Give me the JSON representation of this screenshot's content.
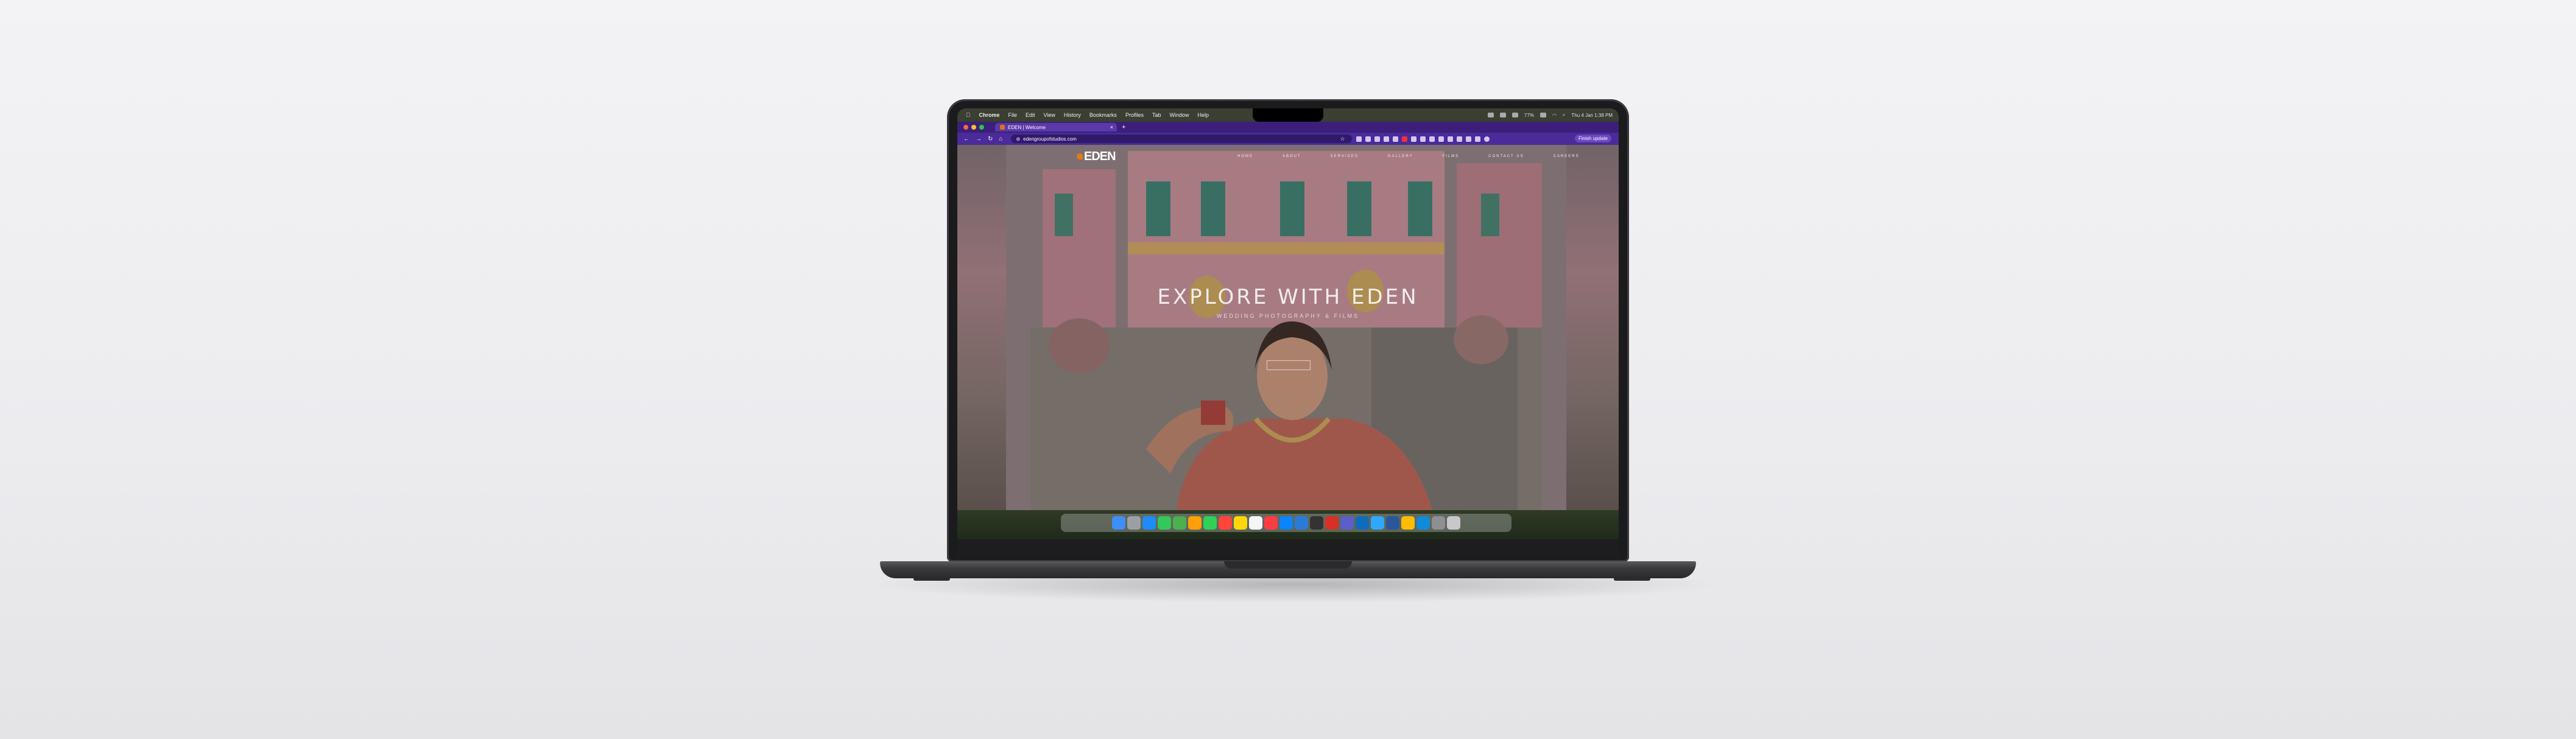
{
  "menubar": {
    "app_name": "Chrome",
    "items": [
      "File",
      "Edit",
      "View",
      "History",
      "Bookmarks",
      "Profiles",
      "Tab",
      "Window",
      "Help"
    ],
    "battery": "77%",
    "clock": "Thu 4 Jan  1:38 PM"
  },
  "browser": {
    "tab_title": "EDEN | Welcome",
    "new_tab": "+",
    "url": "edengroupofstudios.com",
    "finish_update": "Finish update"
  },
  "site": {
    "logo_text": "EDEN",
    "nav": [
      "HOME",
      "ABOUT",
      "SERVICES",
      "GALLERY",
      "FILMS",
      "CONTACT US",
      "CAREERS"
    ],
    "hero_title": "EXPLORE WITH EDEN",
    "hero_subtitle": "WEDDING PHOTOGRAPHY & FILMS"
  },
  "dock": {
    "apps": [
      "finder",
      "launchpad",
      "safari",
      "messages",
      "maps",
      "photos",
      "facetime",
      "calendar",
      "notes",
      "reminders",
      "music",
      "app-store",
      "vscode",
      "terminal",
      "acrobat",
      "teams",
      "outlook",
      "photoshop",
      "word",
      "chrome",
      "edge",
      "preview",
      "trash"
    ]
  },
  "colors": {
    "tab_bar": "#3b1f7a",
    "address_bar": "#4b2a9a",
    "logo_accent": "#e07b1a"
  }
}
